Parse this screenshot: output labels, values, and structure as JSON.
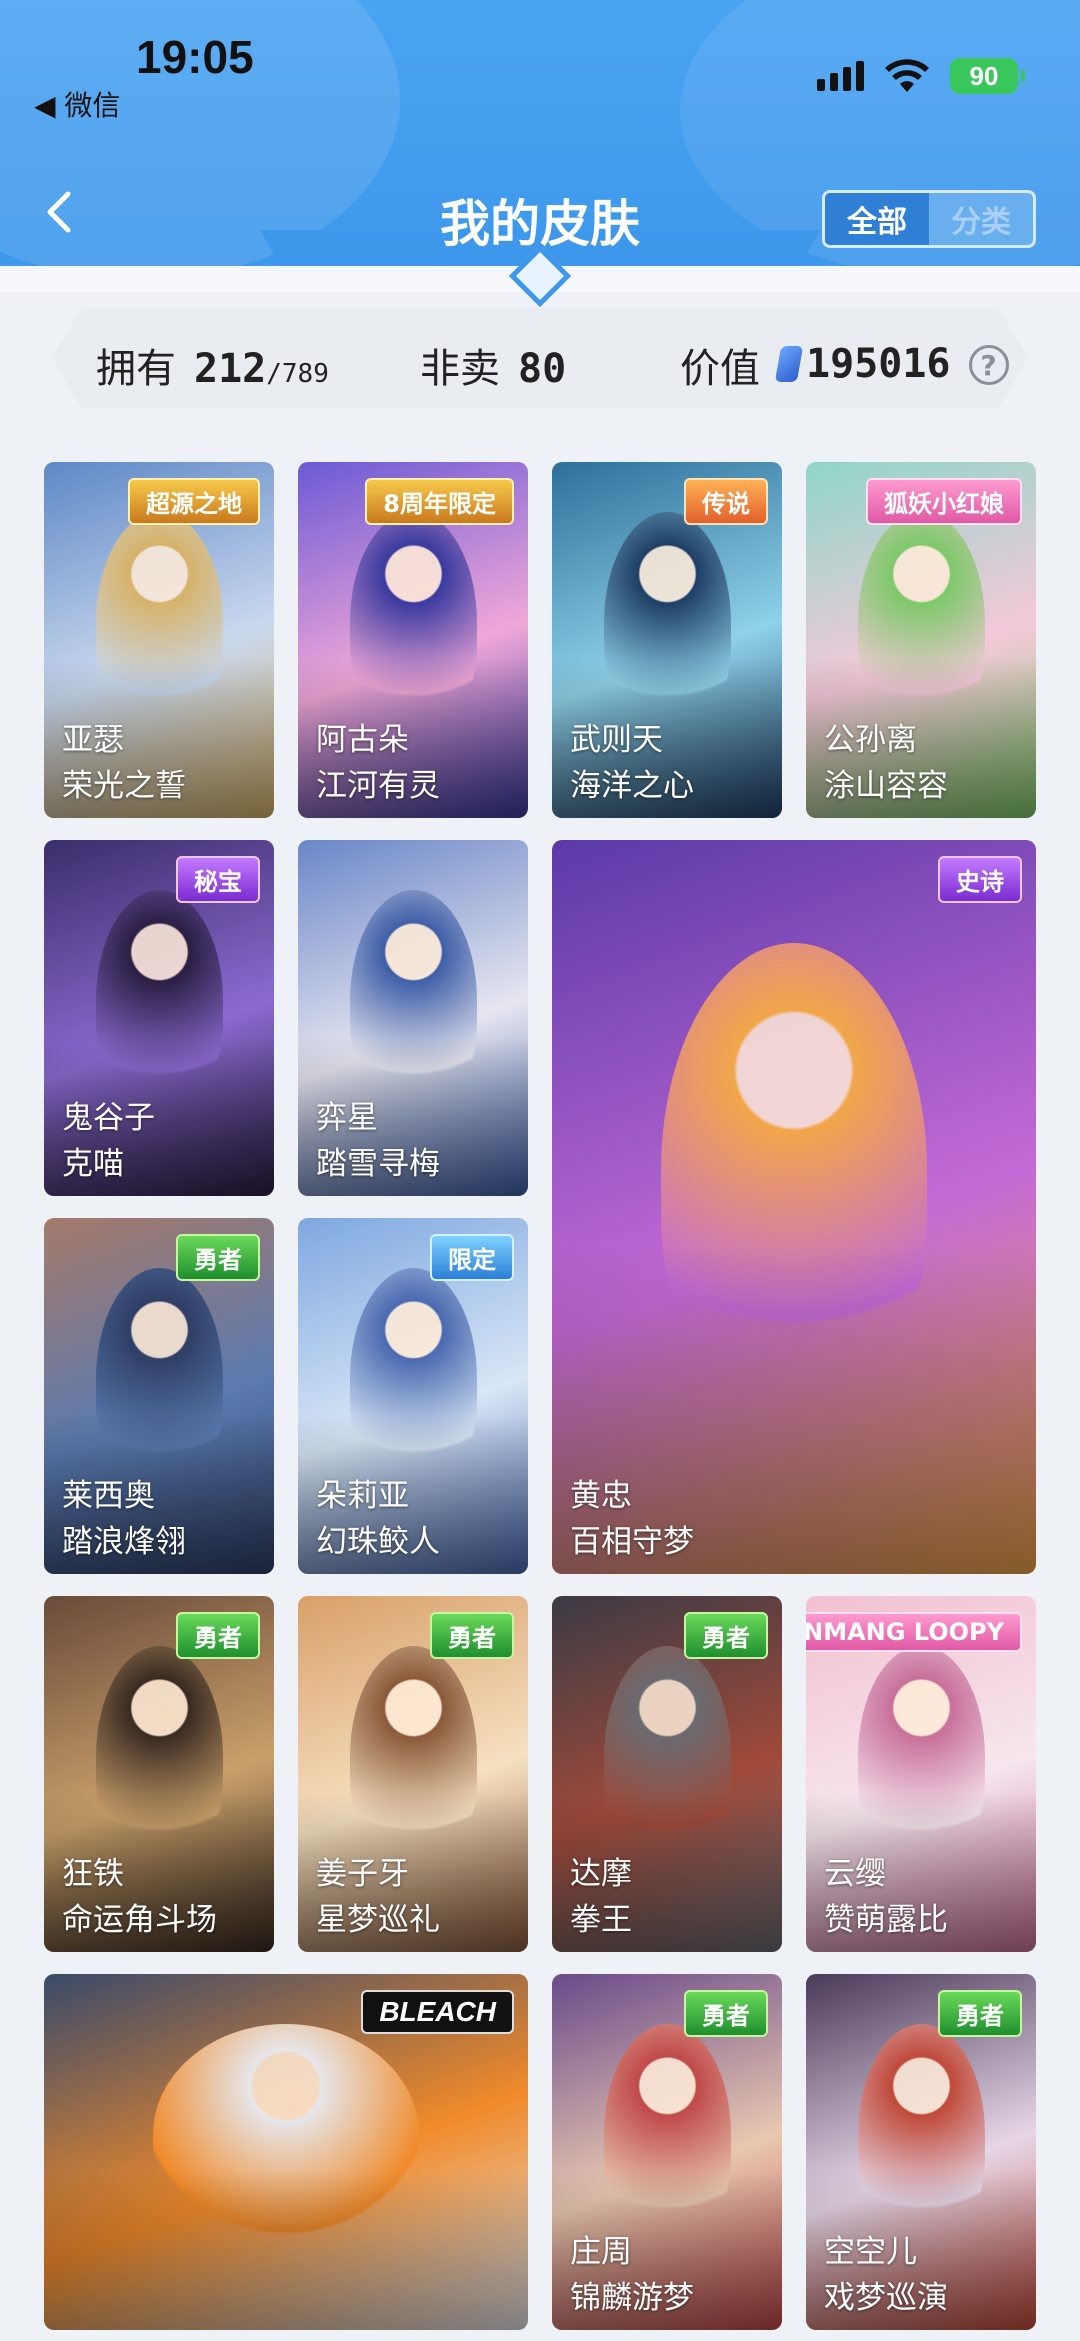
{
  "status_bar": {
    "time": "19:05",
    "back_app": "◀ 微信",
    "battery": "90"
  },
  "header": {
    "title": "我的皮肤",
    "tabs": [
      {
        "label": "全部",
        "active": true
      },
      {
        "label": "分类",
        "active": false
      }
    ]
  },
  "stats": {
    "owned_label": "拥有",
    "owned_value": "212",
    "owned_total": "/789",
    "nonsale_label": "非卖",
    "nonsale_value": "80",
    "value_label": "价值",
    "value_amount": "195016",
    "help": "?"
  },
  "cards": [
    {
      "hero": "亚瑟",
      "skin": "荣光之誓",
      "badge": "超源之地",
      "badge_style": "gold"
    },
    {
      "hero": "阿古朵",
      "skin": "江河有灵",
      "badge": "8周年限定",
      "badge_style": "gold"
    },
    {
      "hero": "武则天",
      "skin": "海洋之心",
      "badge": "传说",
      "badge_style": "orange"
    },
    {
      "hero": "公孙离",
      "skin": "涂山容容",
      "badge": "狐妖小红娘",
      "badge_style": "pink"
    },
    {
      "hero": "鬼谷子",
      "skin": "克喵",
      "badge": "秘宝",
      "badge_style": "purple"
    },
    {
      "hero": "弈星",
      "skin": "踏雪寻梅",
      "badge": "",
      "badge_style": ""
    },
    {
      "hero": "黄忠",
      "skin": "百相守梦",
      "badge": "史诗",
      "badge_style": "purple"
    },
    {
      "hero": "莱西奥",
      "skin": "踏浪烽翎",
      "badge": "勇者",
      "badge_style": "green"
    },
    {
      "hero": "朵莉亚",
      "skin": "幻珠鲛人",
      "badge": "限定",
      "badge_style": "blue"
    },
    {
      "hero": "狂铁",
      "skin": "命运角斗场",
      "badge": "勇者",
      "badge_style": "green"
    },
    {
      "hero": "姜子牙",
      "skin": "星梦巡礼",
      "badge": "勇者",
      "badge_style": "green"
    },
    {
      "hero": "达摩",
      "skin": "拳王",
      "badge": "勇者",
      "badge_style": "green"
    },
    {
      "hero": "云缨",
      "skin": "赞萌露比",
      "badge": "ZANMANG LOOPY",
      "badge_style": "pink"
    },
    {
      "hero": "",
      "skin": "",
      "badge": "BLEACH",
      "badge_style": "logo"
    },
    {
      "hero": "庄周",
      "skin": "锦麟游梦",
      "badge": "勇者",
      "badge_style": "green"
    },
    {
      "hero": "空空儿",
      "skin": "戏梦巡演",
      "badge": "勇者",
      "badge_style": "green"
    }
  ],
  "colors": {
    "header_blue": "#3d97ea",
    "tab_active": "#2f7fd6",
    "page_bg": "#eef1f5"
  }
}
